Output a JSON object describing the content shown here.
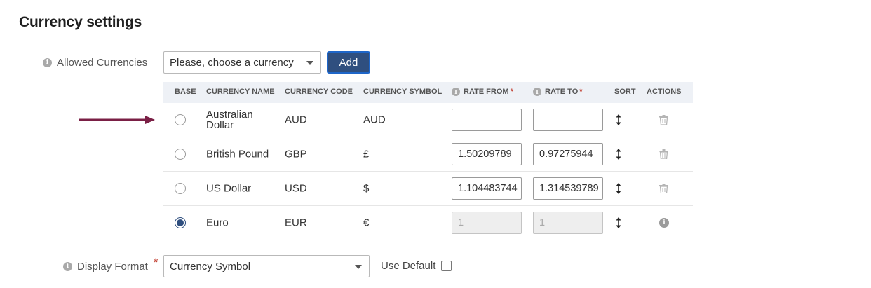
{
  "page": {
    "title": "Currency settings"
  },
  "allowed_currencies": {
    "label": "Allowed Currencies",
    "select_value": "Please, choose a currency",
    "add_label": "Add"
  },
  "table": {
    "headers": {
      "base": "BASE",
      "name": "CURRENCY NAME",
      "code": "CURRENCY CODE",
      "symbol": "CURRENCY SYMBOL",
      "rate_from": "RATE FROM",
      "rate_to": "RATE TO",
      "sort": "SORT",
      "actions": "ACTIONS",
      "required_mark": "*"
    },
    "rows": [
      {
        "name": "Australian Dollar",
        "code": "AUD",
        "symbol": "AUD",
        "rate_from": "",
        "rate_to": "",
        "base": false
      },
      {
        "name": "British Pound",
        "code": "GBP",
        "symbol": "£",
        "rate_from": "1.50209789",
        "rate_to": "0.97275944",
        "base": false
      },
      {
        "name": "US Dollar",
        "code": "USD",
        "symbol": "$",
        "rate_from": "1.104483744",
        "rate_to": "1.314539789",
        "base": false
      },
      {
        "name": "Euro",
        "code": "EUR",
        "symbol": "€",
        "rate_from": "1",
        "rate_to": "1",
        "base": true
      }
    ]
  },
  "display_format": {
    "label": "Display Format",
    "required_mark": "*",
    "select_value": "Currency Symbol",
    "use_default_label": "Use Default"
  },
  "icons": {
    "info": "info-icon",
    "sort": "vertical-arrows-icon",
    "delete": "trash-icon",
    "annotation_arrow": "right-arrow-icon"
  },
  "colors": {
    "primary_button": "#2f4f7f",
    "button_border": "#1e66c9",
    "header_bg": "#eef1f6",
    "arrow": "#7a1f45",
    "required": "#c0392b"
  }
}
